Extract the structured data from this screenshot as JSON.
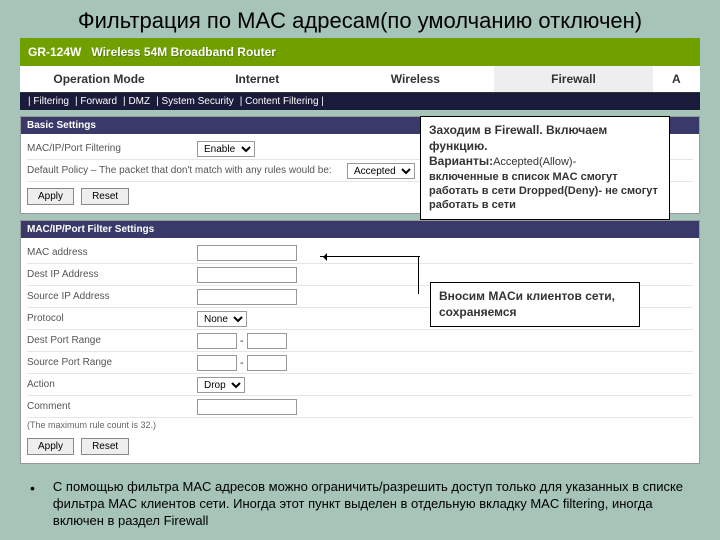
{
  "slide": {
    "title": "Фильтрация по MAC адресам(по умолчанию отключен)"
  },
  "header": {
    "model": "GR-124W",
    "tagline": "Wireless 54M Broadband Router"
  },
  "mainTabs": [
    "Operation Mode",
    "Internet",
    "Wireless",
    "Firewall",
    "A"
  ],
  "subTabs": [
    "Filtering",
    "Forward",
    "DMZ",
    "System Security",
    "Content Filtering"
  ],
  "basic": {
    "heading": "Basic Settings",
    "row1": {
      "label": "MAC/IP/Port Filtering",
      "value": "Enable"
    },
    "row2": {
      "label": "Default Policy – The packet that don't match with any rules would be:",
      "value": "Accepted"
    },
    "apply": "Apply",
    "reset": "Reset"
  },
  "filter": {
    "heading": "MAC/IP/Port Filter Settings",
    "mac": "MAC address",
    "dip": "Dest IP Address",
    "sip": "Source IP Address",
    "proto": "Protocol",
    "proto_val": "None",
    "dport": "Dest Port Range",
    "sport": "Source Port Range",
    "action": "Action",
    "action_val": "Drop",
    "comment": "Comment",
    "note": "(The maximum rule count is 32.)",
    "apply": "Apply",
    "reset": "Reset"
  },
  "callout1": {
    "l1": "Заходим в Firewall. Включаем функцию.",
    "l2a": "Варианты:",
    "l2b": "Accepted(Allow)-",
    "l3": "включенные в список MAC смогут работать в сети  Dropped(Deny)- не смогут работать в сети"
  },
  "callout2": {
    "text": "Вносим MACи клиентов сети, сохраняемся"
  },
  "footer": {
    "text": "С помощью фильтра MAC адресов можно ограничить/разрешить доступ только для указанных в списке фильтра MAC клиентов сети. Иногда этот пункт выделен в отдельную вкладку MAC filtering, иногда включен в раздел Firewall"
  }
}
